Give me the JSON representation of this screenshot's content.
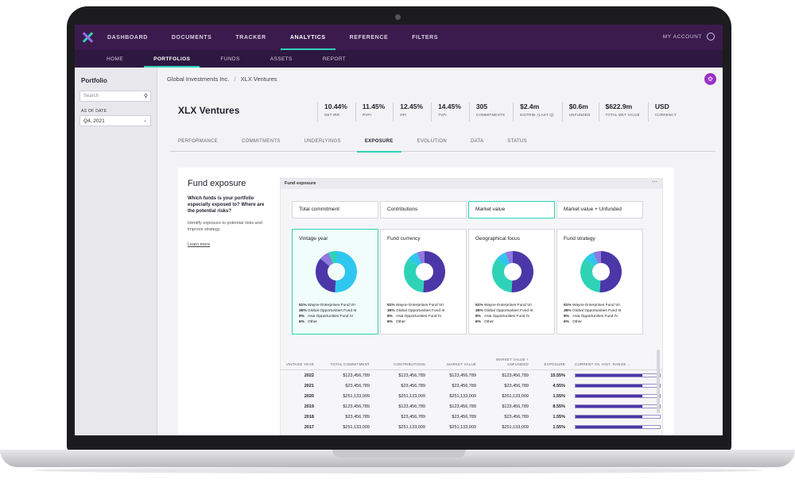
{
  "topnav": {
    "items": [
      "DASHBOARD",
      "DOCUMENTS",
      "TRACKER",
      "ANALYTICS",
      "REFERENCE",
      "FILTERS"
    ],
    "active": "ANALYTICS",
    "account": "MY ACCOUNT"
  },
  "subnav": {
    "items": [
      "HOME",
      "PORTFOLIOS",
      "FUNDS",
      "ASSETS",
      "REPORT"
    ],
    "active": "PORTFOLIOS"
  },
  "sidebar": {
    "title": "Portfolio",
    "search_placeholder": "Search",
    "as_of_label": "AS OF DATE",
    "as_of_value": "Q4, 2021"
  },
  "breadcrumb": {
    "parent": "Global Investments Inc.",
    "separator": "/",
    "current": "XLX Ventures"
  },
  "header": {
    "title": "XLX Ventures",
    "kpis": [
      {
        "value": "10.44%",
        "label": "NET IRR"
      },
      {
        "value": "11.45%",
        "label": "RVPI"
      },
      {
        "value": "12.45%",
        "label": "DPI"
      },
      {
        "value": "14.45%",
        "label": "TVPI"
      },
      {
        "value": "305",
        "label": "COMMITMENTS"
      },
      {
        "value": "$2.4m",
        "label": "DISTRIB. (LAST Q)"
      },
      {
        "value": "$0.6m",
        "label": "UNFUNDED"
      },
      {
        "value": "$622.9m",
        "label": "TOTAL MKT VALUE"
      },
      {
        "value": "USD",
        "label": "CURRENCY"
      }
    ]
  },
  "tabs": [
    "PERFORMANCE",
    "COMMITMENTS",
    "UNDERLYINGS",
    "EXPOSURE",
    "EVOLUTION",
    "DATA",
    "STATUS"
  ],
  "active_tab": "EXPOSURE",
  "exposure": {
    "title": "Fund exposure",
    "question": "Which funds is your portfolio especially exposed to? Where are the potential risks?",
    "description": "Identify exposure to potential risks and improve strategy",
    "link": "Learn more",
    "panel_title": "Fund exposure",
    "panel_menu": "···",
    "metric_tabs": [
      "Total commitment",
      "Contributions",
      "Market value",
      "Market value + Unfunded"
    ],
    "active_metric": "Market value",
    "donuts": [
      {
        "title": "Vintage year",
        "colors": [
          "#2fc7ef",
          "#4b37a8",
          "#8f7ae0",
          "#2ed3b7"
        ]
      },
      {
        "title": "Fund currency",
        "colors": [
          "#4b37a8",
          "#2ed3b7",
          "#2fc7ef",
          "#8f7ae0"
        ]
      },
      {
        "title": "Geographical focus",
        "colors": [
          "#4b37a8",
          "#2ed3b7",
          "#2fc7ef",
          "#8f7ae0"
        ]
      },
      {
        "title": "Fund strategy",
        "colors": [
          "#4b37a8",
          "#2ed3b7",
          "#2fc7ef",
          "#8f7ae0"
        ]
      }
    ],
    "legend": [
      {
        "pct": "51%",
        "name": "Wayne Enterprises Fund VII",
        "value": 51
      },
      {
        "pct": "35%",
        "name": "Global Opportunities Fund III",
        "value": 35
      },
      {
        "pct": "8%",
        "name": "Asia Opportunities Fund IV",
        "value": 8
      },
      {
        "pct": "6%",
        "name": "Other",
        "value": 6
      }
    ],
    "table": {
      "headers": [
        "VINTAGE YEAR",
        "TOTAL COMMITMENT",
        "CONTRIBUTIONS",
        "MARKET VALUE",
        "MARKET VALUE + UNFUNDED",
        "EXPOSURE",
        "CURRENT VS. HIST. RANGE ↓"
      ],
      "rows": [
        {
          "year": "2022",
          "total": "$123,456,789",
          "contrib": "$123,456,789",
          "mv": "$123,456,789",
          "mvu": "$123,456,789",
          "exposure": "15.55%",
          "range": 0.79
        },
        {
          "year": "2021",
          "total": "$23,456,789",
          "contrib": "$23,456,789",
          "mv": "$23,456,789",
          "mvu": "$23,456,789",
          "exposure": "4.55%",
          "range": 0.79
        },
        {
          "year": "2020",
          "total": "$251,133,009",
          "contrib": "$251,133,009",
          "mv": "$251,133,009",
          "mvu": "$251,133,009",
          "exposure": "1.55%",
          "range": 0.79
        },
        {
          "year": "2019",
          "total": "$123,456,789",
          "contrib": "$123,456,789",
          "mv": "$123,456,789",
          "mvu": "$123,456,789",
          "exposure": "8.55%",
          "range": 0.79
        },
        {
          "year": "2018",
          "total": "$23,456,789",
          "contrib": "$23,456,789",
          "mv": "$23,456,789",
          "mvu": "$23,456,789",
          "exposure": "1.55%",
          "range": 0.79
        },
        {
          "year": "2017",
          "total": "$251,133,009",
          "contrib": "$251,133,009",
          "mv": "$251,133,009",
          "mvu": "$251,133,009",
          "exposure": "1.55%",
          "range": 0.79
        }
      ]
    }
  }
}
